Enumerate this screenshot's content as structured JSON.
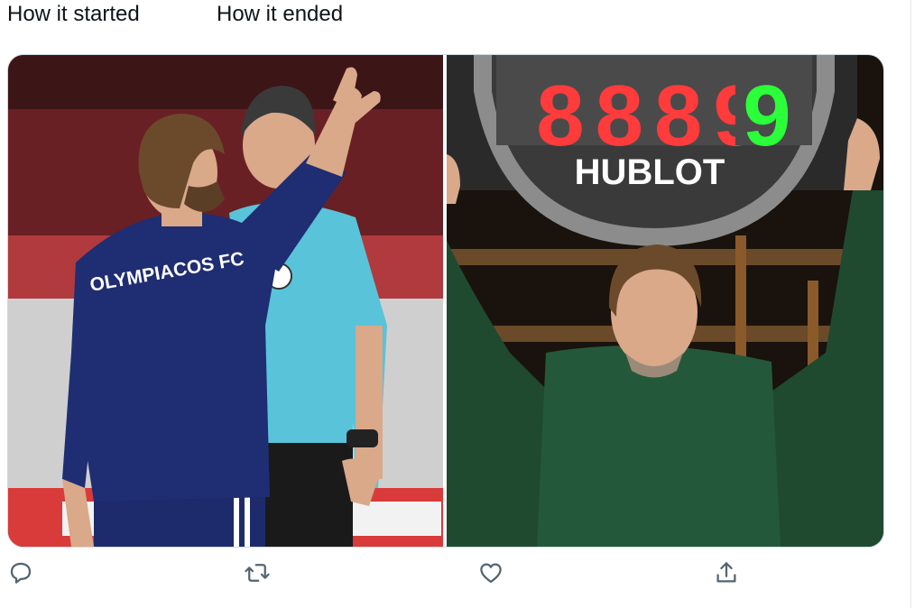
{
  "captions": {
    "left": "How it started",
    "right": "How it ended"
  },
  "media": {
    "left": {
      "shirt_text": "OLYMPIACOS FC"
    },
    "right": {
      "board_text": "HUBLOT",
      "board_digits": "8889"
    }
  },
  "icons": {
    "reply": "reply-icon",
    "retweet": "retweet-icon",
    "like": "heart-icon",
    "share": "share-icon"
  },
  "colors": {
    "text": "#0f1419",
    "icon": "#536471",
    "board_red": "#ff3b3b",
    "board_green": "#2bff3a"
  }
}
